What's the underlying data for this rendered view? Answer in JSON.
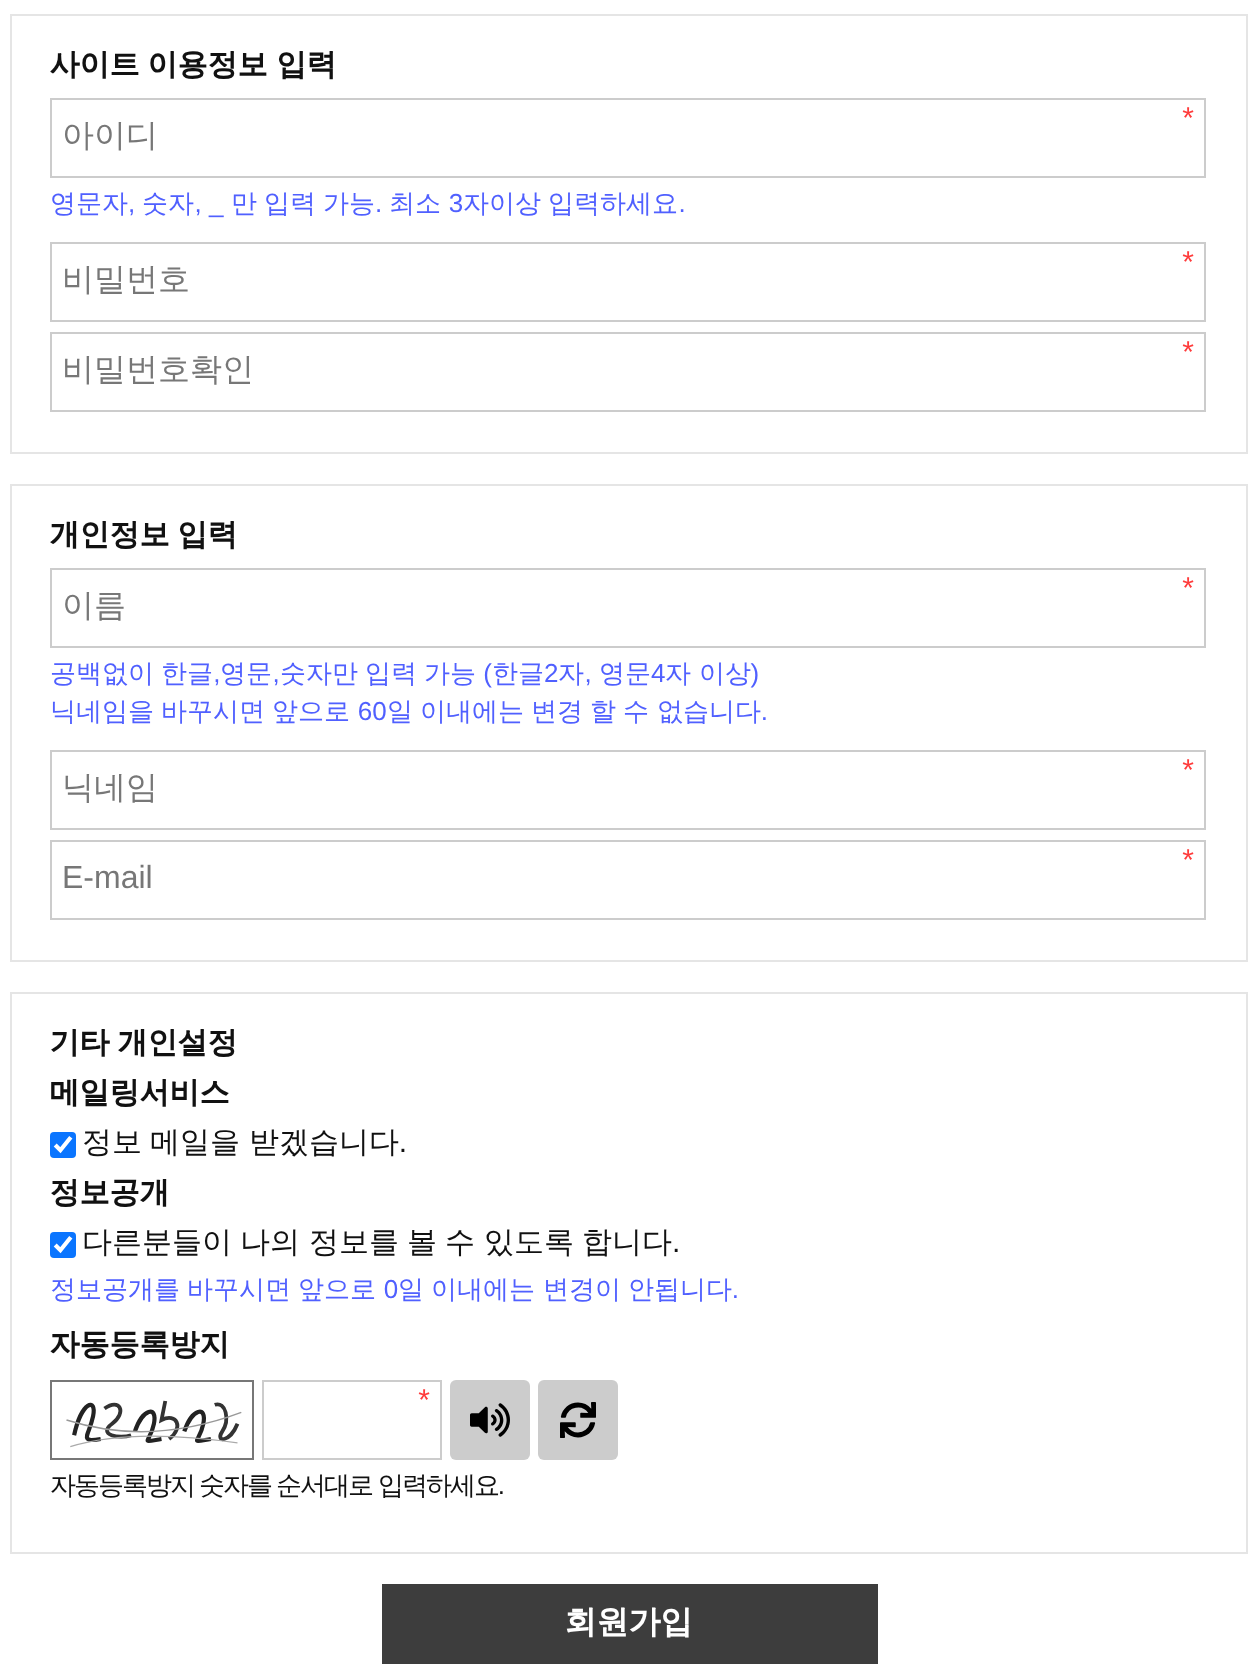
{
  "sections": [
    {
      "title": "사이트 이용정보 입력",
      "items": [
        {
          "kind": "field",
          "placeholder": "아이디",
          "mark": "*"
        },
        {
          "kind": "help",
          "lines": [
            "영문자, 숫자, _ 만 입력 가능. 최소 3자이상 입력하세요."
          ]
        },
        {
          "kind": "field",
          "placeholder": "비밀번호",
          "mark": "*"
        },
        {
          "kind": "field",
          "placeholder": "비밀번호확인",
          "mark": "*"
        }
      ]
    },
    {
      "title": "개인정보 입력",
      "items": [
        {
          "kind": "field",
          "placeholder": "이름",
          "mark": "*"
        },
        {
          "kind": "help",
          "lines": [
            "공백없이 한글,영문,숫자만 입력 가능 (한글2자, 영문4자 이상)",
            "닉네임을 바꾸시면 앞으로 60일 이내에는 변경 할 수 없습니다."
          ]
        },
        {
          "kind": "field",
          "placeholder": "닉네임",
          "mark": "*"
        },
        {
          "kind": "field",
          "placeholder": "E-mail",
          "mark": "*"
        }
      ]
    },
    {
      "title": "기타 개인설정",
      "items": [
        {
          "kind": "subtitle",
          "text": "메일링서비스"
        },
        {
          "kind": "checkbox",
          "label": "정보 메일을 받겠습니다.",
          "checked": true
        },
        {
          "kind": "subtitle",
          "text": "정보공개"
        },
        {
          "kind": "checkbox",
          "label": "다른분들이 나의 정보를 볼 수 있도록 합니다.",
          "checked": true
        },
        {
          "kind": "help",
          "lines": [
            "정보공개를 바꾸시면 앞으로 0일 이내에는 변경이 안됩니다."
          ]
        },
        {
          "kind": "subtitle",
          "text": "자동등록방지"
        },
        {
          "kind": "captcha",
          "mark": "*"
        },
        {
          "kind": "note",
          "text": "자동등록방지 숫자를 순서대로 입력하세요."
        }
      ]
    }
  ],
  "submit": "회원가입"
}
